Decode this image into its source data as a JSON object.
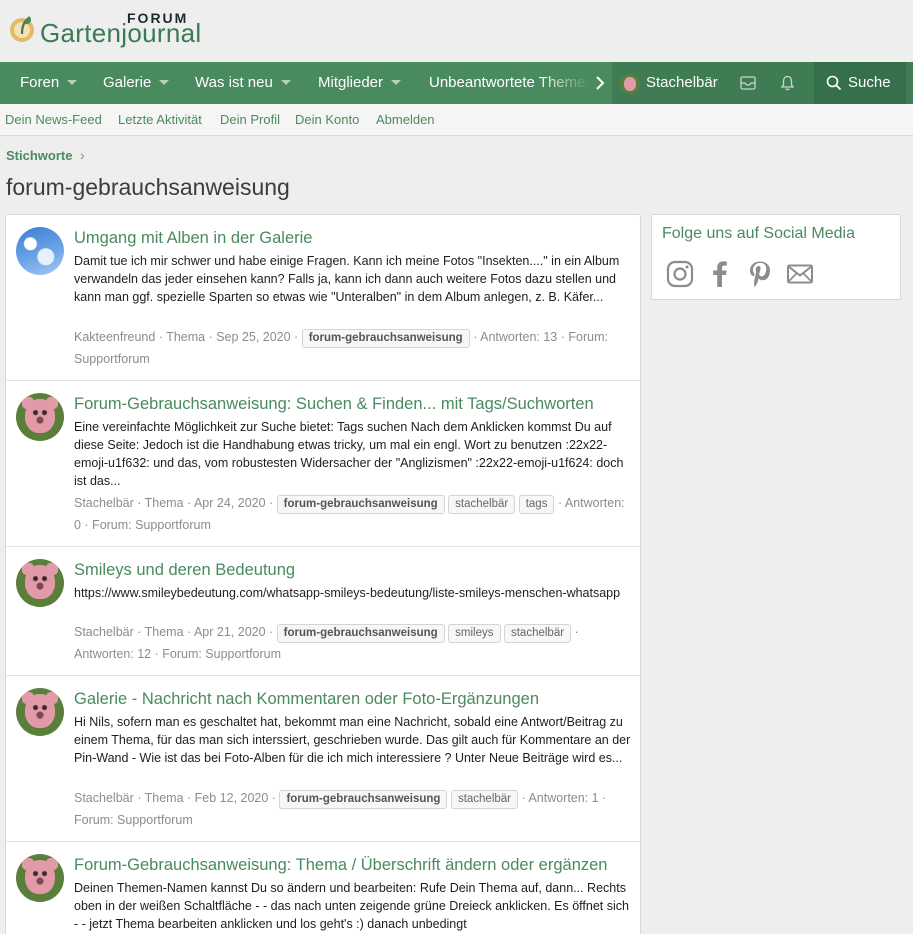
{
  "brand": {
    "forum": "FORUM",
    "name": "Gartenjournal"
  },
  "nav": {
    "items": [
      "Foren",
      "Galerie",
      "Was ist neu",
      "Mitglieder",
      "Unbeantwortete Themen"
    ],
    "user": "Stachelbär",
    "search": "Suche"
  },
  "subnav": [
    "Dein News-Feed",
    "Letzte Aktivität",
    "Dein Profil",
    "Dein Konto",
    "Abmelden"
  ],
  "breadcrumb": "Stichworte",
  "page_title": "forum-gebrauchsanweisung",
  "results": [
    {
      "title": "Umgang mit Alben in der Galerie",
      "snippet": "Damit tue ich mir schwer und habe einige Fragen. Kann ich meine Fotos \"Insekten....\" in ein Album verwandeln das jeder einsehen kann? Falls ja, kann ich dann auch weitere Fotos dazu stellen und kann man ggf. spezielle Sparten so etwas wie \"Unteralben\" in dem Album anlegen, z. B. Käfer...",
      "meta_start": "Kakteenfreund · Thema · Sep 25, 2020 ·",
      "tags": [
        "forum-gebrauchsanweisung"
      ],
      "meta_end": "· Antworten: 13 · Forum: Supportforum"
    },
    {
      "title": "Forum-Gebrauchsanweisung: Suchen & Finden... mit Tags/Suchworten",
      "snippet": "Eine vereinfachte Möglichkeit zur Suche bietet: Tags suchen Nach dem Anklicken kommst Du auf diese Seite: Jedoch ist die Handhabung etwas tricky, um mal ein engl. Wort zu benutzen :22x22-emoji-u1f632: und das, vom robustesten Widersacher der \"Anglizismen\" :22x22-emoji-u1f624: doch ist das...",
      "meta_start": "Stachelbär · Thema · Apr 24, 2020 ·",
      "tags": [
        "forum-gebrauchsanweisung",
        "stachelbär",
        "tags"
      ],
      "meta_end": "· Antworten: 0 · Forum: Supportforum"
    },
    {
      "title": "Smileys und deren Bedeutung",
      "snippet": "https://www.smileybedeutung.com/whatsapp-smileys-bedeutung/liste-smileys-menschen-whatsapp",
      "meta_start": "Stachelbär · Thema · Apr 21, 2020 ·",
      "tags": [
        "forum-gebrauchsanweisung",
        "smileys",
        "stachelbär"
      ],
      "meta_end": "· Antworten: 12 · Forum: Supportforum"
    },
    {
      "title": "Galerie - Nachricht nach Kommentaren oder Foto-Ergänzungen",
      "snippet": "Hi Nils, sofern man es geschaltet hat, bekommt man eine Nachricht, sobald eine Antwort/Beitrag zu einem Thema, für das man sich interssiert, geschrieben wurde. Das gilt auch für Kommentare an der Pin-Wand - Wie ist das bei Foto-Alben für die ich mich interessiere ? Unter Neue Beiträge wird es...",
      "meta_start": "Stachelbär · Thema · Feb 12, 2020 ·",
      "tags": [
        "forum-gebrauchsanweisung",
        "stachelbär"
      ],
      "meta_end": "· Antworten: 1 · Forum: Supportforum"
    },
    {
      "title": "Forum-Gebrauchsanweisung: Thema / Überschrift ändern oder ergänzen",
      "snippet": "Deinen Themen-Namen kannst Du so ändern und bearbeiten: Rufe Dein Thema auf, dann... Rechts oben in der weißen Schaltfläche - - das nach unten zeigende grüne Dreieck anklicken. Es öffnet sich - - jetzt Thema bearbeiten anklicken und los geht's :) danach unbedingt",
      "meta_start": "",
      "tags": [],
      "meta_end": ""
    }
  ],
  "sidebar": {
    "title": "Folge uns auf Social Media",
    "icons": [
      "instagram-icon",
      "facebook-icon",
      "pinterest-icon",
      "mail-icon"
    ]
  },
  "colors": {
    "accent": "#4a8a5f",
    "nav_bg": "#4a8a5f",
    "link": "#4a8a5f",
    "meta": "#8c8c8c"
  }
}
